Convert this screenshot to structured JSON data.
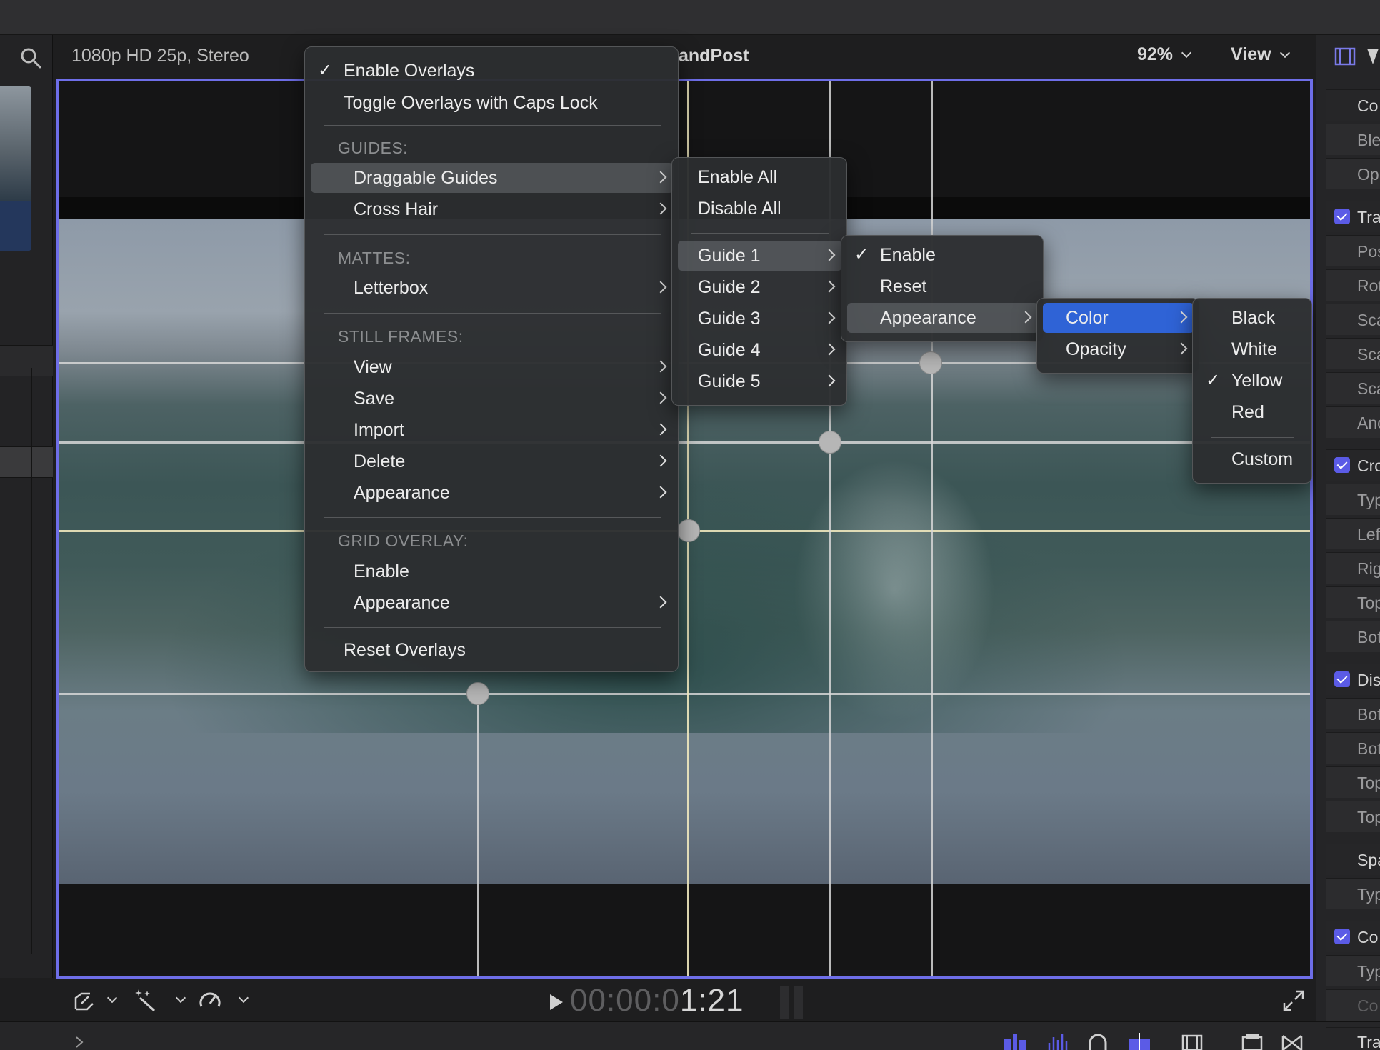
{
  "viewer": {
    "format": "1080p HD 25p, Stereo",
    "project_suffix": "andPost",
    "zoom": "92%",
    "view_label": "View"
  },
  "main_menu": {
    "enable_overlays": "Enable Overlays",
    "toggle_caps": "Toggle Overlays with Caps Lock",
    "guides_header": "GUIDES:",
    "draggable_guides": "Draggable Guides",
    "cross_hair": "Cross Hair",
    "mattes_header": "MATTES:",
    "letterbox": "Letterbox",
    "still_header": "STILL FRAMES:",
    "view": "View",
    "save": "Save",
    "import": "Import",
    "delete": "Delete",
    "appearance": "Appearance",
    "grid_header": "GRID OVERLAY:",
    "grid_enable": "Enable",
    "grid_appearance": "Appearance",
    "reset_overlays": "Reset Overlays"
  },
  "guides_menu": {
    "enable_all": "Enable All",
    "disable_all": "Disable All",
    "guides": [
      "Guide 1",
      "Guide 2",
      "Guide 3",
      "Guide 4",
      "Guide 5"
    ]
  },
  "guide1_menu": {
    "enable": "Enable",
    "reset": "Reset",
    "appearance": "Appearance"
  },
  "appearance_menu": {
    "color": "Color",
    "opacity": "Opacity"
  },
  "color_menu": {
    "items": [
      "Black",
      "White",
      "Yellow",
      "Red"
    ],
    "custom": "Custom",
    "selected": "Yellow"
  },
  "transport": {
    "timecode_dim": "00:00:0",
    "timecode_bright": "1:21"
  },
  "inspector": {
    "rows": [
      "Co",
      "Ble",
      "Op",
      "Tra",
      "Pos",
      "Rot",
      "Sca",
      "Sca",
      "Sca",
      "Anc",
      "Cro",
      "Typ",
      "Lef",
      "Rig",
      "Top",
      "Bot",
      "Dis",
      "Bot",
      "Bot",
      "Top",
      "Top",
      "Spa",
      "Typ",
      "Co",
      "Typ",
      "Co",
      "Tra"
    ]
  },
  "colors": {
    "accent": "#6e6ee8",
    "menu_selection": "#2f63d6",
    "checkbox": "#5b5be6"
  }
}
